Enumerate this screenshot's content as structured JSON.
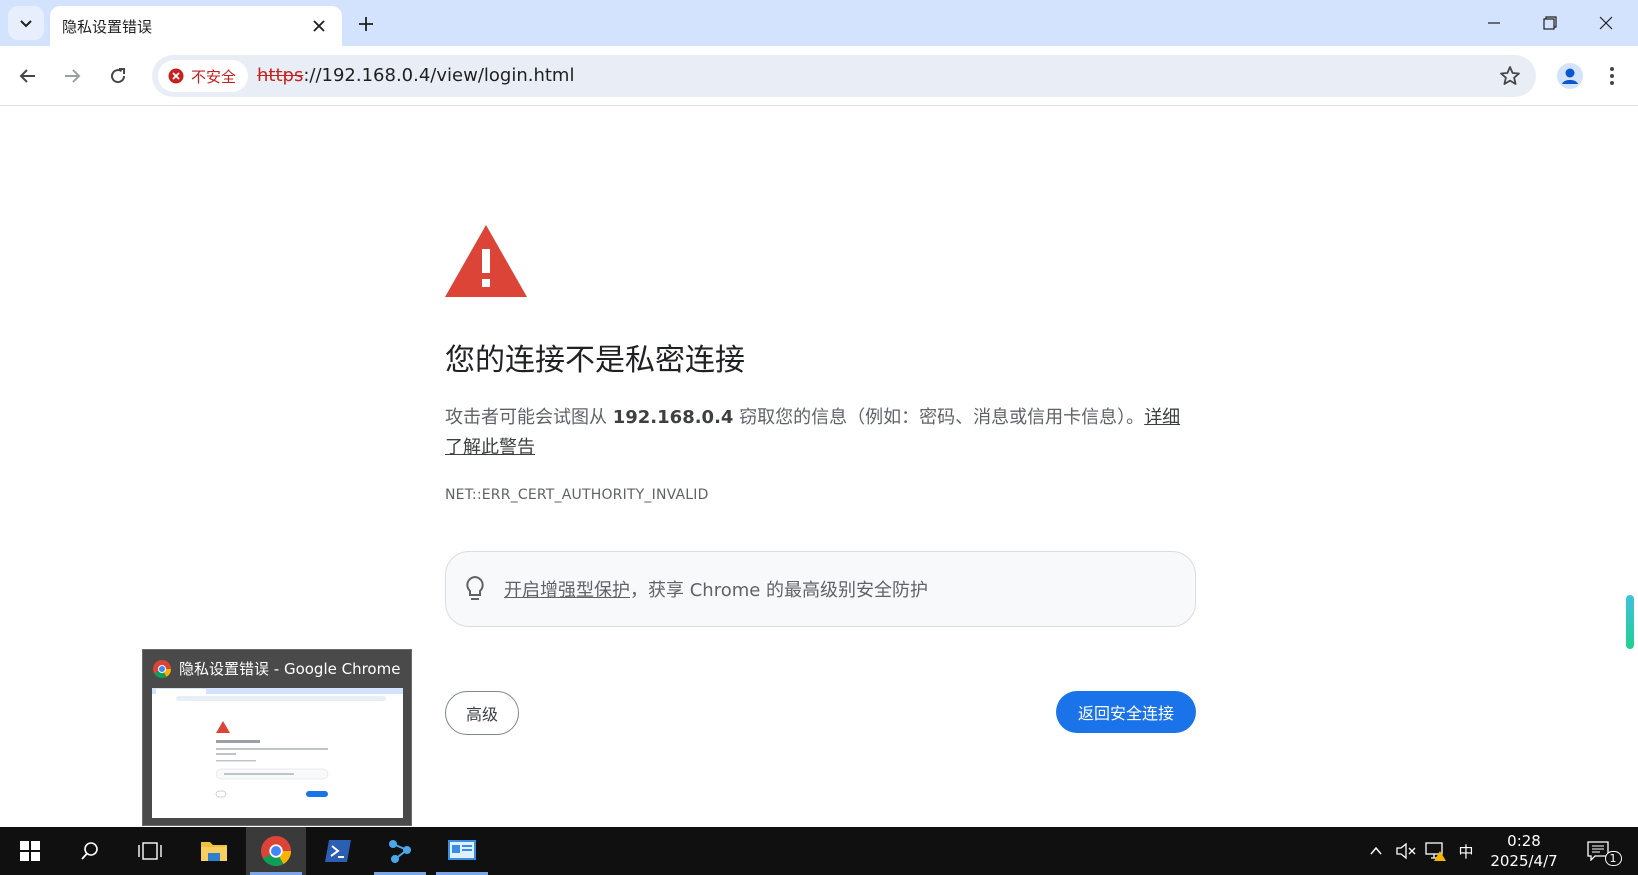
{
  "tab": {
    "title": "隐私设置错误"
  },
  "omnibox": {
    "security_label": "不安全",
    "url_scheme": "https",
    "url_rest": "://192.168.0.4/view/login.html"
  },
  "interstitial": {
    "heading": "您的连接不是私密连接",
    "body_prefix": "攻击者可能会试图从",
    "host": "192.168.0.4",
    "body_suffix": "窃取您的信息（例如：密码、消息或信用卡信息）。",
    "learn_more": "详细了解此警告",
    "error_code": "NET::ERR_CERT_AUTHORITY_INVALID",
    "enhanced_link": "开启增强型保护",
    "enhanced_suffix": "，获享 Chrome 的最高级别安全防护",
    "advanced_button": "高级",
    "back_button": "返回安全连接"
  },
  "preview": {
    "title": "隐私设置错误 - Google Chrome"
  },
  "taskbar": {
    "ime": "中",
    "time": "0:28",
    "date": "2025/4/7",
    "notification_count": "1"
  },
  "colors": {
    "accent": "#1a73e8",
    "danger": "#c5221f",
    "warning_red": "#db4437",
    "titlebar": "#d3e3fd",
    "taskbar": "#101010"
  }
}
